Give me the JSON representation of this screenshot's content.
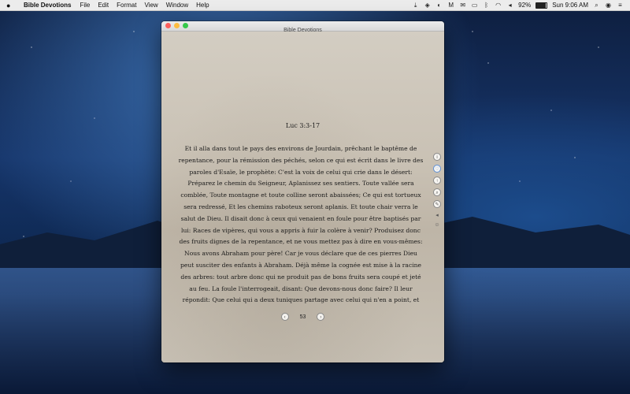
{
  "menubar": {
    "app_name": "Bible Devotions",
    "items": [
      "File",
      "Edit",
      "Format",
      "View",
      "Window",
      "Help"
    ],
    "battery_percent": 92,
    "battery_text": "92%",
    "clock": "Sun 9:06 AM",
    "status_icons": [
      "download-icon",
      "shield-icon",
      "puzzle-icon",
      "malwarebytes-icon",
      "mail-icon",
      "airplay-icon",
      "bluetooth-icon",
      "wifi-icon",
      "volume-icon",
      "spotlight-search-icon",
      "user-icon",
      "list-icon"
    ]
  },
  "window": {
    "title": "Bible Devotions",
    "reference": "Luc 3:3-17",
    "text": "Et il alla dans tout le pays des environs de Jourdain, prêchant le baptême de repentance, pour la rémission des péchés, selon ce qui est écrit dans le livre des paroles d'Esaïe, le prophète: C'est la voix de celui qui crie dans le désert: Préparez le chemin du Seigneur, Aplanissez ses sentiers. Toute vallée sera comblée, Toute montagne et toute colline seront abaissées; Ce qui est tortueux sera redressé, Et les chemins raboteux seront aplanis. Et toute chair verra le salut de Dieu. Il disait donc à ceux qui venaient en foule pour être baptisés par lui: Races de vipères, qui vous a appris à fuir la colère à venir? Produisez donc des fruits dignes de la repentance, et ne vous mettez pas à dire en vous-mêmes: Nous avons Abraham pour père! Car je vous déclare que de ces pierres Dieu peut susciter des enfants à Abraham. Déjà même la cognée est mise à la racine des arbres: tout arbre donc qui ne produit pas de bons fruits sera coupé et jeté au feu. La foule l'interrogeait, disant: Que devons-nous donc faire? Il leur répondit: Que celui qui a deux tuniques partage avec celui qui n'en a point, et que celui qui a de quoi manger agisse de même. Il vint aussi des publicains pour être baptisés, et ils",
    "page_number": "53",
    "prev_glyph": "‹",
    "next_glyph": "›"
  },
  "side_tools": [
    {
      "name": "info-icon",
      "glyph": "i"
    },
    {
      "name": "heart-icon",
      "glyph": "♡",
      "selected": true
    },
    {
      "name": "share-icon",
      "glyph": "↑"
    },
    {
      "name": "search-icon",
      "glyph": "⌕"
    },
    {
      "name": "pencil-icon",
      "glyph": "✎"
    },
    {
      "name": "volume-icon",
      "glyph": "◂"
    },
    {
      "name": "person-icon",
      "glyph": "☺"
    }
  ]
}
